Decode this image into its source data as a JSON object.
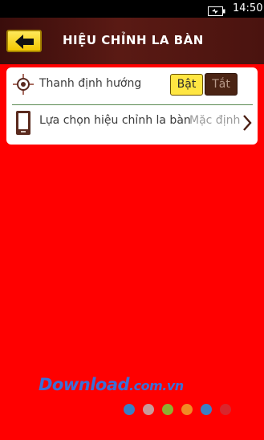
{
  "status_bar": {
    "battery_icon": "battery-charging-icon",
    "time": "14:50"
  },
  "header": {
    "back_icon": "arrow-left-icon",
    "title": "HIỆU CHỈNH LA BÀN",
    "accent_color": "#ffe642"
  },
  "settings": {
    "orientation_bar": {
      "icon": "crosshair-icon",
      "label": "Thanh định hướng",
      "on_label": "Bật",
      "off_label": "Tắt",
      "selected": "Bật"
    },
    "calibration_choice": {
      "icon": "phone-icon",
      "label": "Lựa chọn hiệu chỉnh la bàn",
      "value": "Mặc định",
      "chevron_icon": "chevron-right-icon"
    }
  },
  "watermark": {
    "brand": "Download",
    "suffix": ".com.vn"
  },
  "watermark_dots": [
    "#3b7fc4",
    "#c99a9a",
    "#8fae32",
    "#f08a24",
    "#3b7fc4",
    "#d9262c"
  ],
  "background_color": "#ff0000"
}
